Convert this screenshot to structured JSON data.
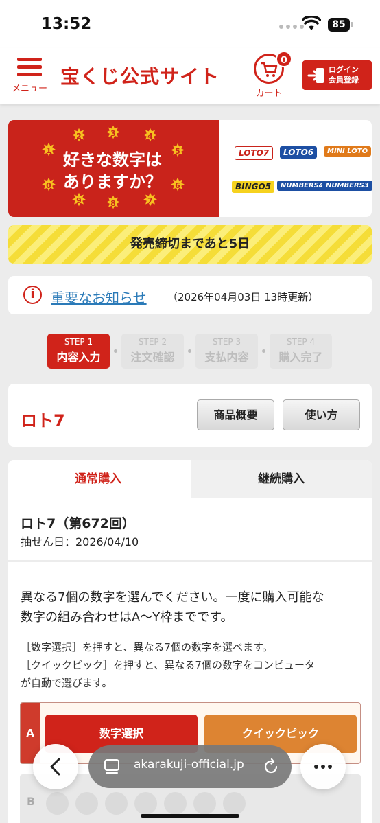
{
  "status_bar": {
    "time": "13:52",
    "battery": "85"
  },
  "header": {
    "menu_label": "メニュー",
    "logo": "宝くじ公式サイト",
    "cart_label": "カート",
    "cart_count": "0",
    "login_line1": "ログイン",
    "login_line2": "会員登録"
  },
  "banner": {
    "line1": "好きな数字は",
    "line2": "ありますか？",
    "ball_numbers": [
      "1",
      "2",
      "3",
      "4",
      "5",
      "0",
      "6",
      "9",
      "8",
      "7"
    ],
    "brands": [
      "LOTO7",
      "LOTO6",
      "MINI LOTO",
      "BINGO5",
      "NUMBERS4",
      "NUMBERS3"
    ]
  },
  "deadline": "発売締切まであと5日",
  "notice": {
    "link": "重要なお知らせ",
    "date": "（2026年04月03日 13時更新）"
  },
  "steps": [
    {
      "num": "STEP 1",
      "label": "内容入力"
    },
    {
      "num": "STEP 2",
      "label": "注文確認"
    },
    {
      "num": "STEP 3",
      "label": "支払内容"
    },
    {
      "num": "STEP 4",
      "label": "購入完了"
    }
  ],
  "product": {
    "title": "ロト7",
    "btn_overview": "商品概要",
    "btn_howto": "使い方"
  },
  "tabs": {
    "normal": "通常購入",
    "continuous": "継続購入"
  },
  "draw": {
    "title": "ロト7（第672回）",
    "date": "抽せん日：2026/04/10"
  },
  "desc": {
    "main_l1": "異なる7個の数字を選んでください。一度に購入可能な",
    "main_l2": "数字の組み合わせはA〜Y枠までです。",
    "sub_l1": "［数字選択］を押すと、異なる7個の数字を選べます。",
    "sub_l2": "［クイックピック］を押すと、異なる7個の数字をコンピュータ",
    "sub_l3": "が自動で選びます。"
  },
  "rows": {
    "a_label": "A",
    "b_label": "B",
    "select_btn": "数字選択",
    "quick_btn": "クイックピック"
  },
  "browser": {
    "url": "akarakuji-official.jp"
  },
  "colors": {
    "brand_red": "#d0231a",
    "quick_orange": "#dd8432",
    "link_blue": "#2a7ab8"
  }
}
